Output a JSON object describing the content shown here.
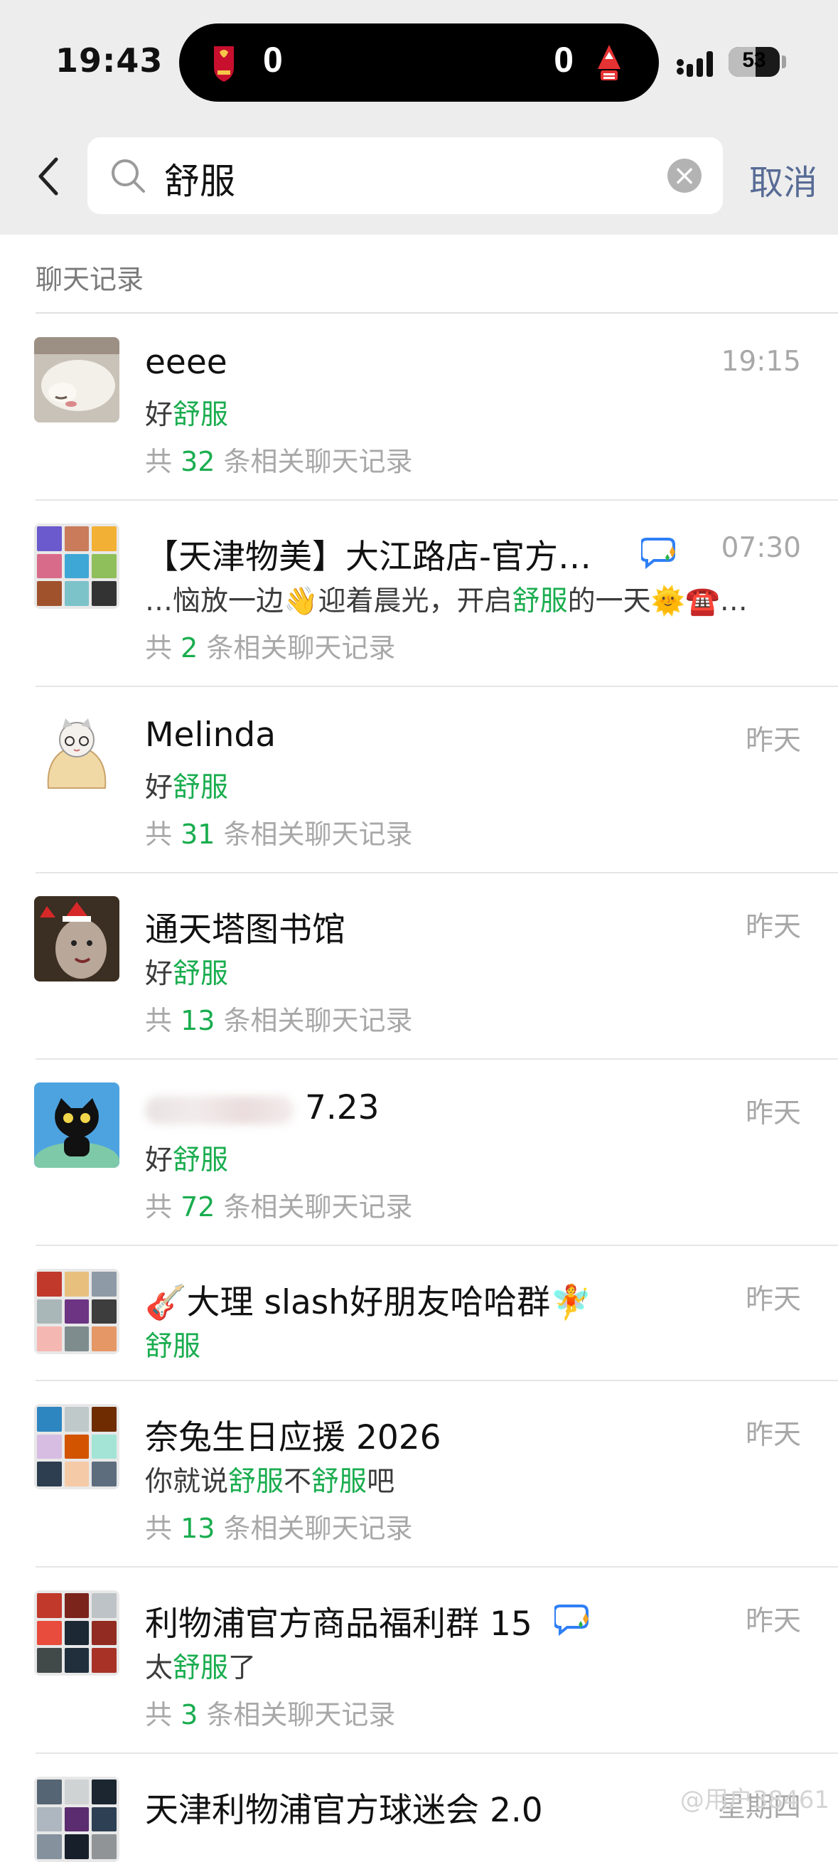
{
  "status_bar": {
    "time": "19:43",
    "score_left": "0",
    "score_right": "0",
    "battery": "53",
    "battery_fraction": 0.53
  },
  "search": {
    "query": "舒服",
    "cancel_label": "取消"
  },
  "section": {
    "title": "聊天记录"
  },
  "count_template": {
    "prefix": "共 ",
    "suffix": " 条相关聊天记录"
  },
  "results": [
    {
      "name": "eeee",
      "time": "19:15",
      "snippet": [
        {
          "t": "好"
        },
        {
          "t": "舒服",
          "hl": true
        }
      ],
      "count": "32",
      "avatar": "photo-sleeping-dog"
    },
    {
      "name": "【天津物美】大江路店-官方…",
      "time": "07:30",
      "snippet": [
        {
          "t": "…恼放一边👋迎着晨光，开启"
        },
        {
          "t": "舒服",
          "hl": true
        },
        {
          "t": "的一天🌞☎️…"
        }
      ],
      "count": "2",
      "avatar": "group-grid",
      "ai_icon": true
    },
    {
      "name": "Melinda",
      "time": "昨天",
      "snippet": [
        {
          "t": "好"
        },
        {
          "t": "舒服",
          "hl": true
        }
      ],
      "count": "31",
      "avatar": "cartoon-cat-blanket"
    },
    {
      "name": "通天塔图书馆",
      "time": "昨天",
      "snippet": [
        {
          "t": "好"
        },
        {
          "t": "舒服",
          "hl": true
        }
      ],
      "count": "13",
      "avatar": "photo-christmas-hats"
    },
    {
      "name": "7.23",
      "name_blurred": true,
      "time": "昨天",
      "snippet": [
        {
          "t": "好"
        },
        {
          "t": "舒服",
          "hl": true
        }
      ],
      "count": "72",
      "avatar": "black-cat-cartoon"
    },
    {
      "name": "🎸大理 slash好朋友哈哈群🧚",
      "time": "昨天",
      "snippet": [
        {
          "t": "舒服",
          "hl": true
        }
      ],
      "count": null,
      "avatar": "group-grid"
    },
    {
      "name": "奈兔生日应援 2026",
      "time": "昨天",
      "snippet": [
        {
          "t": "你就说"
        },
        {
          "t": "舒服",
          "hl": true
        },
        {
          "t": "不"
        },
        {
          "t": "舒服",
          "hl": true
        },
        {
          "t": "吧"
        }
      ],
      "count": "13",
      "avatar": "group-grid"
    },
    {
      "name": "利物浦官方商品福利群 15",
      "time": "昨天",
      "snippet": [
        {
          "t": "太"
        },
        {
          "t": "舒服",
          "hl": true
        },
        {
          "t": "了"
        }
      ],
      "count": "3",
      "avatar": "group-grid",
      "ai_icon": true
    },
    {
      "name": "天津利物浦官方球迷会 2.0",
      "time": "星期四",
      "snippet": [],
      "count": null,
      "avatar": "group-grid"
    }
  ],
  "watermark": "@用户38461",
  "colors": {
    "highlight": "#1aad4f",
    "link": "#576b95",
    "header_bg": "#ededed"
  }
}
